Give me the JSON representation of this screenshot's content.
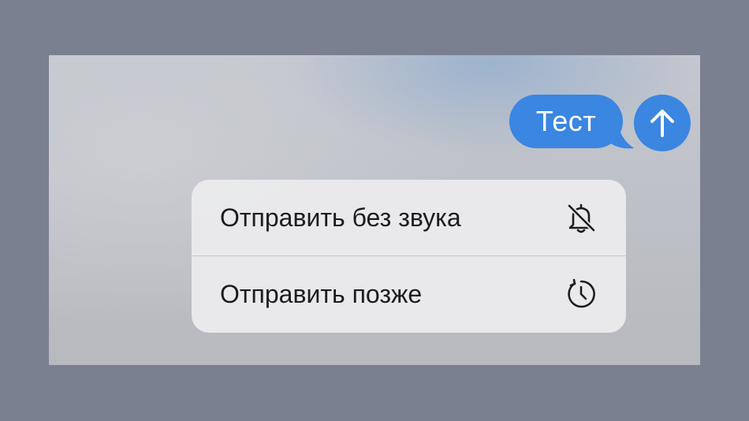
{
  "message": {
    "text": "Тест",
    "bubble_color": "#3a86e0"
  },
  "send_button": {
    "icon": "arrow-up-icon",
    "color": "#3a86e0"
  },
  "menu": {
    "items": [
      {
        "label": "Отправить без звука",
        "icon": "bell-slash-icon"
      },
      {
        "label": "Отправить позже",
        "icon": "clock-arrow-icon"
      }
    ]
  }
}
